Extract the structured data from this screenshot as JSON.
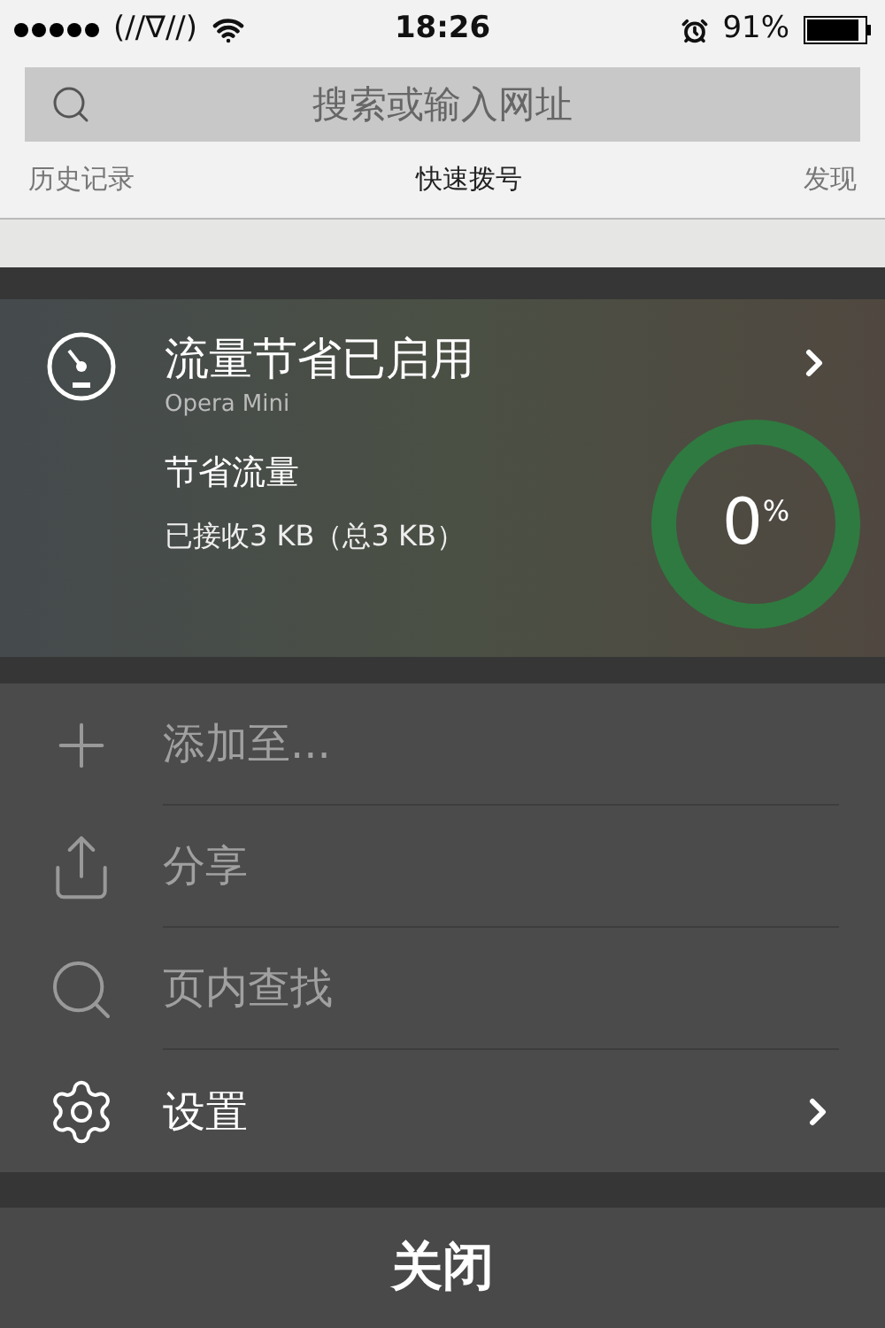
{
  "status_bar": {
    "carrier": "(//∇//)",
    "time": "18:26",
    "battery": "91%"
  },
  "search": {
    "placeholder": "搜索或输入网址"
  },
  "tabs": [
    {
      "label": "历史记录",
      "selected": false
    },
    {
      "label": "快速拨号",
      "selected": true
    },
    {
      "label": "发现",
      "selected": false
    }
  ],
  "savings_card": {
    "title": "流量节省已启用",
    "subtitle": "Opera Mini",
    "heading": "节省流量",
    "detail": "已接收3 KB（总3 KB）",
    "percent": "0",
    "percent_sign": "%"
  },
  "menu": [
    {
      "kind": "add",
      "label": "添加至...",
      "disabled": true,
      "chevron": false
    },
    {
      "kind": "share",
      "label": "分享",
      "disabled": true,
      "chevron": false
    },
    {
      "kind": "find",
      "label": "页内查找",
      "disabled": true,
      "chevron": false
    },
    {
      "kind": "settings",
      "label": "设置",
      "disabled": false,
      "chevron": true
    }
  ],
  "close_button": "关闭"
}
